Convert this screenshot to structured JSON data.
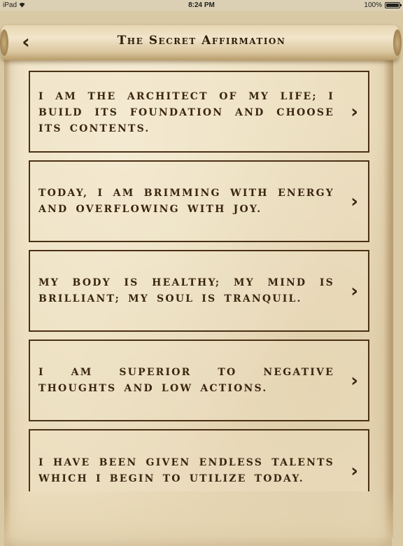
{
  "status_bar": {
    "device": "iPad",
    "time": "8:24 PM",
    "battery": "100%"
  },
  "header": {
    "title": "The Secret Affirmation",
    "back_icon": "chevron-left-icon"
  },
  "affirmations": [
    {
      "text": "I am the architect of my life; I build its foundation and choose its contents."
    },
    {
      "text": "Today, I am brimming with energy and overflowing with joy."
    },
    {
      "text": "My body is healthy; my mind is brilliant; my soul is tranquil."
    },
    {
      "text": "I am superior to negative thoughts and low actions."
    },
    {
      "text": "I have been given endless talents which I begin to utilize today."
    }
  ],
  "colors": {
    "ink": "#3a2511",
    "paper": "#eadcbc",
    "border": "#4a3015"
  }
}
